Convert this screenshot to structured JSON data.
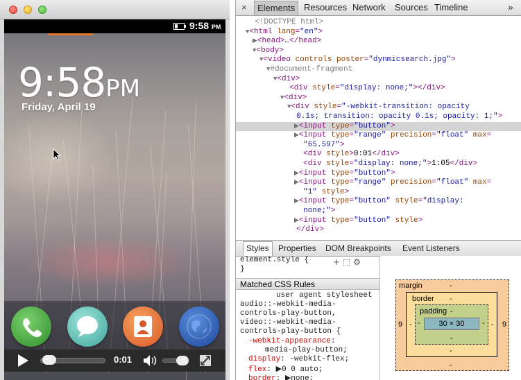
{
  "simulator": {
    "status_time": "9:58",
    "status_ampm": "PM",
    "lock_time": "9:58",
    "lock_ampm": "PM",
    "lock_date": "Friday, April 19",
    "dock_apps": [
      "phone-icon",
      "messages-icon",
      "contacts-icon",
      "browser-icon"
    ],
    "media": {
      "current_time": "0:01",
      "progress": 0.015
    }
  },
  "devtools": {
    "close": "×",
    "tabs": [
      "Elements",
      "Resources",
      "Network",
      "Sources",
      "Timeline"
    ],
    "active_tab": "Elements",
    "more": "»",
    "dom_lines": [
      {
        "indent": 0,
        "arrow": "",
        "html": "<span class='cm'>&lt;!DOCTYPE html&gt;</span>"
      },
      {
        "indent": 0,
        "arrow": "▼",
        "html": "<span class='t'>&lt;html</span> <span class='an'>lang</span>=<span class='av'>\"en\"</span><span class='t'>&gt;</span>"
      },
      {
        "indent": 1,
        "arrow": "▶",
        "html": "<span class='t'>&lt;head&gt;</span><span class='tx'>…</span><span class='t'>&lt;/head&gt;</span>"
      },
      {
        "indent": 1,
        "arrow": "▼",
        "html": "<span class='t'>&lt;body&gt;</span>"
      },
      {
        "indent": 2,
        "arrow": "▼",
        "html": "<span class='t'>&lt;video</span> <span class='an'>controls</span> <span class='an'>poster</span>=<span class='av'>\"dynmicsearch.jpg\"</span><span class='t'>&gt;</span>"
      },
      {
        "indent": 3,
        "arrow": "▼",
        "html": "<span class='cm'>#document-fragment</span>"
      },
      {
        "indent": 4,
        "arrow": "▼",
        "html": "<span class='t'>&lt;div&gt;</span>"
      },
      {
        "indent": 5,
        "arrow": "",
        "html": "<span class='t'>&lt;div</span> <span class='an'>style</span>=<span class='av'>\"display: none;\"</span><span class='t'>&gt;&lt;/div&gt;</span>"
      },
      {
        "indent": 5,
        "arrow": "▼",
        "html": "<span class='t'>&lt;div&gt;</span>"
      },
      {
        "indent": 6,
        "arrow": "▼",
        "html": "<span class='t'>&lt;div</span> <span class='an'>style</span>=<span class='av'>\"-webkit-transition: opacity</span>"
      },
      {
        "indent": 6,
        "arrow": "",
        "html": "<span class='av'>0.1s; transition: opacity 0.1s; opacity: 1;\"</span><span class='t'>&gt;</span>"
      },
      {
        "indent": 7,
        "arrow": "▶",
        "html": "<span class='t'>&lt;input</span> <span class='an'>type</span>=<span class='av'>\"button\"</span><span class='t'>&gt;</span>"
      },
      {
        "indent": 7,
        "arrow": "▶",
        "html": "<span class='t'>&lt;input</span> <span class='an'>type</span>=<span class='av'>\"range\"</span> <span class='an'>precision</span>=<span class='av'>\"float\"</span> <span class='an'>max</span>="
      },
      {
        "indent": 7,
        "arrow": "",
        "html": "<span class='av'>\"65.597\"</span><span class='t'>&gt;</span>"
      },
      {
        "indent": 7,
        "arrow": "",
        "html": "<span class='t'>&lt;div</span> <span class='an'>style</span><span class='t'>&gt;</span><span class='tx'>0:01</span><span class='t'>&lt;/div&gt;</span>"
      },
      {
        "indent": 7,
        "arrow": "",
        "html": "<span class='t'>&lt;div</span> <span class='an'>style</span>=<span class='av'>\"display: none;\"</span><span class='t'>&gt;</span><span class='tx'>1:05</span><span class='t'>&lt;/div&gt;</span>"
      },
      {
        "indent": 7,
        "arrow": "▶",
        "html": "<span class='t'>&lt;input</span> <span class='an'>type</span>=<span class='av'>\"button\"</span><span class='t'>&gt;</span>"
      },
      {
        "indent": 7,
        "arrow": "▶",
        "html": "<span class='t'>&lt;input</span> <span class='an'>type</span>=<span class='av'>\"range\"</span> <span class='an'>precision</span>=<span class='av'>\"float\"</span> <span class='an'>max</span>="
      },
      {
        "indent": 7,
        "arrow": "",
        "html": "<span class='av'>\"1\"</span> <span class='an'>style</span><span class='t'>&gt;</span>"
      },
      {
        "indent": 7,
        "arrow": "▶",
        "html": "<span class='t'>&lt;input</span> <span class='an'>type</span>=<span class='av'>\"button\"</span> <span class='an'>style</span>=<span class='av'>\"display:</span>"
      },
      {
        "indent": 7,
        "arrow": "",
        "html": "<span class='av'>none;\"</span><span class='t'>&gt;</span>"
      },
      {
        "indent": 7,
        "arrow": "▶",
        "html": "<span class='t'>&lt;input</span> <span class='an'>type</span>=<span class='av'>\"button\"</span> <span class='an'>style</span><span class='t'>&gt;</span>"
      },
      {
        "indent": 6,
        "arrow": "",
        "html": "<span class='t'>&lt;/div&gt;</span>"
      }
    ],
    "selected_line": 11,
    "lower_tabs": [
      "Styles",
      "Properties",
      "DOM Breakpoints",
      "Event Listeners"
    ],
    "active_lower_tab": "Styles",
    "styles": {
      "element_style": "element.style {",
      "element_style_close": "}",
      "matched_header": "Matched CSS Rules",
      "source": "user agent stylesheet",
      "selectors": [
        "audio::-webkit-media-",
        "controls-play-button,",
        "video::-webkit-media-",
        "controls-play-button {"
      ],
      "props": [
        {
          "name": "-webkit-appearance",
          "value": "",
          "wrap": "media-play-button;"
        },
        {
          "name": "display",
          "value": "-webkit-flex;"
        },
        {
          "name": "flex",
          "value": "▶0 0 auto;"
        },
        {
          "name": "border",
          "value": "▶none;"
        }
      ]
    },
    "box_model": {
      "margin_label": "margin",
      "border_label": "border",
      "padding_label": "padding",
      "content": "30 × 30",
      "dash": "-",
      "margin_left": "9",
      "margin_right": "9"
    }
  }
}
